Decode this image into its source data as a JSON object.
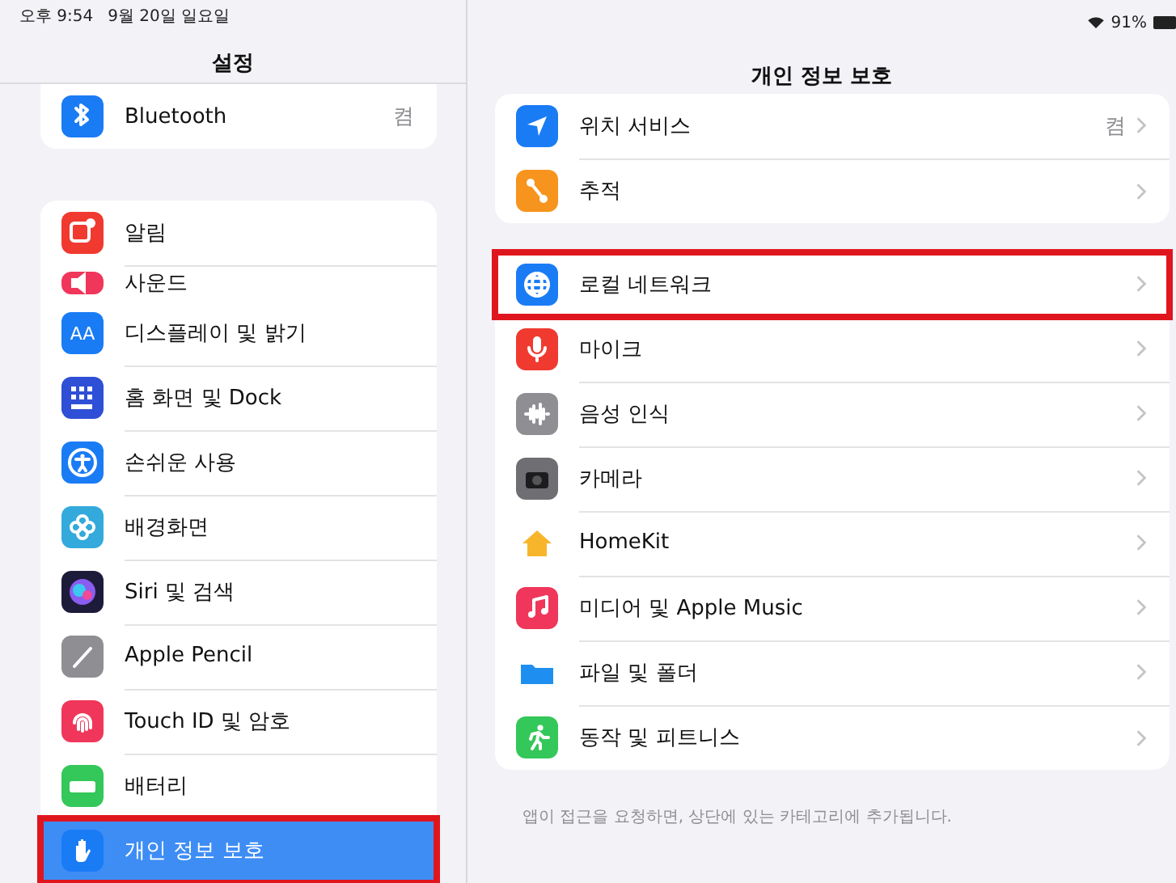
{
  "status_bar": {
    "time": "오후 9:54",
    "date": "9월 20일 일요일",
    "battery": "91%"
  },
  "sidebar": {
    "title": "설정",
    "groups": [
      {
        "items": [
          {
            "label": "Bluetooth",
            "value": "켬",
            "color": "#1a7cf5",
            "kind": "full",
            "selected": false,
            "highlighted": false
          }
        ]
      },
      {
        "items": [
          {
            "label": "알림",
            "color": "#f03a30",
            "kind": "full",
            "selected": false,
            "highlighted": false
          },
          {
            "label": "사운드",
            "color": "#f0365a",
            "kind": "partial",
            "selected": false,
            "highlighted": false
          },
          {
            "label": "디스플레이 및 밝기",
            "color": "#1a7cf5",
            "icon_text": "AA",
            "kind": "full",
            "selected": false,
            "highlighted": false
          },
          {
            "label": "홈 화면 및 Dock",
            "color": "#2f4fd6",
            "kind": "full",
            "selected": false,
            "highlighted": false
          },
          {
            "label": "손쉬운 사용",
            "color": "#1a7cf5",
            "kind": "full",
            "selected": false,
            "highlighted": false
          },
          {
            "label": "배경화면",
            "color": "#34aadc",
            "kind": "full",
            "selected": false,
            "highlighted": false
          },
          {
            "label": "Siri 및 검색",
            "color": "#1c1c3a",
            "kind": "full",
            "selected": false,
            "highlighted": false
          },
          {
            "label": "Apple Pencil",
            "color": "#8e8e93",
            "kind": "full",
            "selected": false,
            "highlighted": false
          },
          {
            "label": "Touch ID 및 암호",
            "color": "#f0365a",
            "kind": "full",
            "selected": false,
            "highlighted": false
          },
          {
            "label": "배터리",
            "color": "#34c759",
            "kind": "full",
            "selected": false,
            "highlighted": false
          },
          {
            "label": "개인 정보 보호",
            "color": "#1a7cf5",
            "kind": "full",
            "selected": true,
            "highlighted": true
          }
        ]
      }
    ]
  },
  "detail": {
    "title": "개인 정보 보호",
    "groups": [
      {
        "items": [
          {
            "label": "위치 서비스",
            "value": "켬",
            "color": "#1a7cf5",
            "highlighted": false
          },
          {
            "label": "추적",
            "color": "#f7941d",
            "highlighted": false
          }
        ]
      },
      {
        "items": [
          {
            "label": "로컬 네트워크",
            "color": "#1a7cf5",
            "highlighted": true
          },
          {
            "label": "마이크",
            "color": "#f03a30",
            "highlighted": false
          },
          {
            "label": "음성 인식",
            "color": "#8e8e93",
            "highlighted": false
          },
          {
            "label": "카메라",
            "color": "#6e6e73",
            "highlighted": false
          },
          {
            "label": "HomeKit",
            "color": "#ffffff",
            "highlighted": false
          },
          {
            "label": "미디어 및 Apple Music",
            "color": "#f0365a",
            "highlighted": false
          },
          {
            "label": "파일 및 폴더",
            "color": "#ffffff",
            "highlighted": false
          },
          {
            "label": "동작 및 피트니스",
            "color": "#34c759",
            "highlighted": false
          }
        ]
      }
    ],
    "footer": "앱이 접근을 요청하면, 상단에 있는 카테고리에 추가됩니다."
  }
}
